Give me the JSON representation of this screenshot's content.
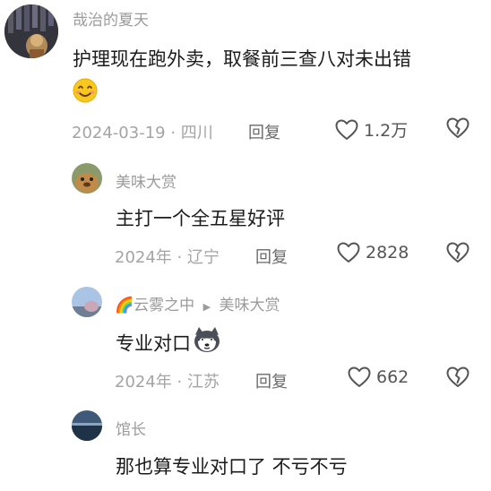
{
  "comments": [
    {
      "user": "哉治的夏天",
      "text": "护理现在跑外卖，取餐前三查八对未出错",
      "date": "2024-03-19",
      "location": "四川",
      "reply_label": "回复",
      "likes": "1.2万",
      "emoji": "smiling-face-emoji"
    },
    {
      "user": "美味大赏",
      "text": "主打一个全五星好评",
      "date": "2024年",
      "location": "辽宁",
      "reply_label": "回复",
      "likes": "2828"
    },
    {
      "user": "🌈云雾之中",
      "reply_to": "美味大赏",
      "text": "专业对口",
      "date": "2024年",
      "location": "江苏",
      "reply_label": "回复",
      "likes": "662",
      "emoji": "husky-dog-emoji"
    },
    {
      "user": "馆长",
      "text": "那也算专业对口了 不亏不亏"
    }
  ],
  "colors": {
    "text": "#1b1b1b",
    "meta": "#a4a4a4",
    "username": "#9b9b9b"
  }
}
